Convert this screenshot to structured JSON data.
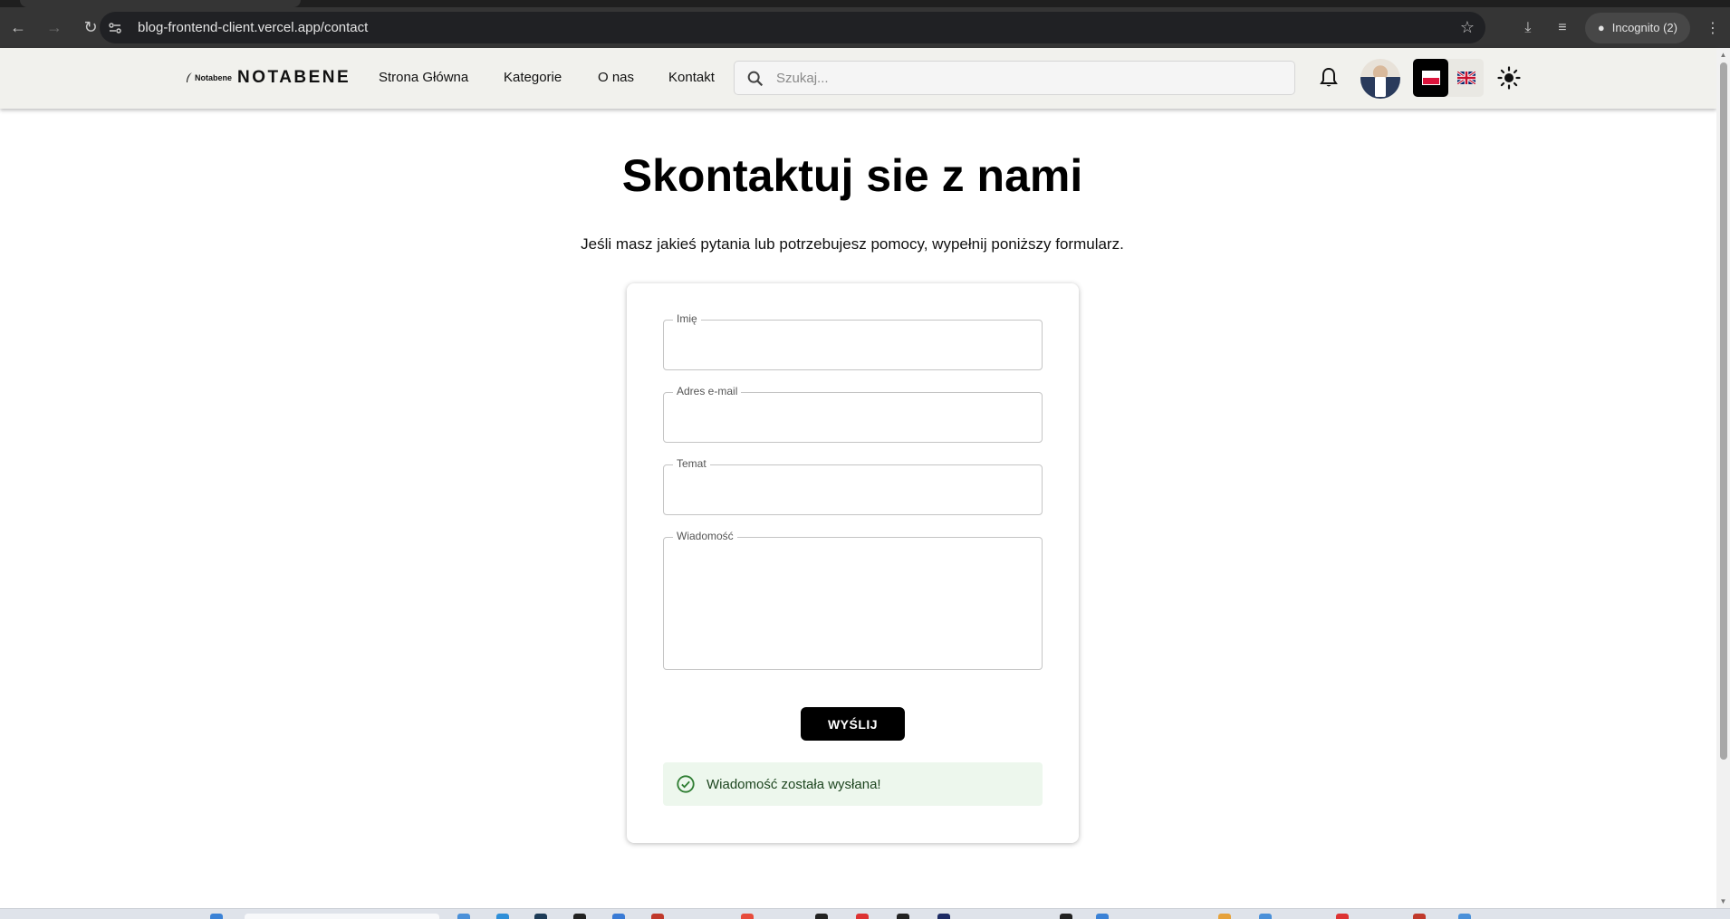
{
  "browser": {
    "url": "blog-frontend-client.vercel.app/contact",
    "incognito_label": "Incognito (2)"
  },
  "header": {
    "logo_small": "Notabene",
    "logo_text": "NOTABENE",
    "nav": [
      {
        "label": "Strona Główna"
      },
      {
        "label": "Kategorie"
      },
      {
        "label": "O nas"
      },
      {
        "label": "Kontakt"
      }
    ],
    "search": {
      "placeholder": "Szukaj...",
      "value": ""
    },
    "icons": {
      "bell": "bell-icon",
      "avatar": "user-avatar",
      "lang_pl": "flag-pl-icon",
      "lang_en": "flag-uk-icon",
      "theme": "sun-icon"
    },
    "active_language": "pl"
  },
  "main": {
    "title": "Skontaktuj sie z nami",
    "subtitle": "Jeśli masz jakieś pytania lub potrzebujesz pomocy, wypełnij poniższy formularz.",
    "form": {
      "fields": [
        {
          "label": "Imię",
          "value": ""
        },
        {
          "label": "Adres e-mail",
          "value": ""
        },
        {
          "label": "Temat",
          "value": ""
        },
        {
          "label": "Wiadomość",
          "value": ""
        }
      ],
      "submit_label": "WYŚLIJ",
      "success_message": "Wiadomość została wysłana!"
    }
  },
  "colors": {
    "header_bg": "#f1f1ed",
    "button_bg": "#000000",
    "success_bg": "#edf7ed",
    "success_text": "#1e4620"
  }
}
